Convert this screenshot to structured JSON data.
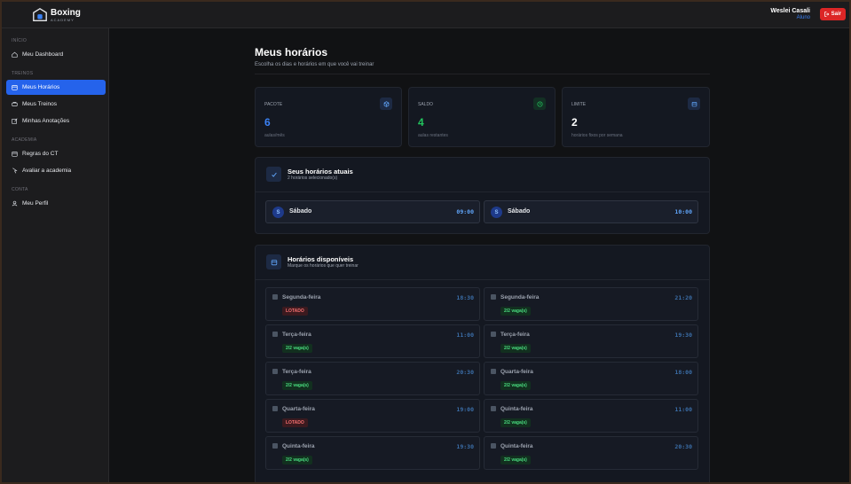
{
  "header": {
    "logo_title": "Boxing",
    "logo_sub": "ACADEMY",
    "user_name": "Weslei Casali",
    "user_role": "Aluno",
    "logout_label": "Sair"
  },
  "sidebar": {
    "sections": [
      {
        "title": "INÍCIO",
        "items": [
          {
            "label": "Meu Dashboard",
            "icon": "home-icon"
          }
        ]
      },
      {
        "title": "TREINOS",
        "items": [
          {
            "label": "Meus Horários",
            "icon": "calendar-icon",
            "active": true
          },
          {
            "label": "Meus Treinos",
            "icon": "dumbbell-icon"
          },
          {
            "label": "Minhas Anotações",
            "icon": "edit-icon"
          }
        ]
      },
      {
        "title": "ACADEMIA",
        "items": [
          {
            "label": "Regras do CT",
            "icon": "calendar-icon"
          },
          {
            "label": "Avaliar a academia",
            "icon": "pointer-icon"
          }
        ]
      },
      {
        "title": "CONTA",
        "items": [
          {
            "label": "Meu Perfil",
            "icon": "user-icon"
          }
        ]
      }
    ]
  },
  "page": {
    "title": "Meus horários",
    "subtitle": "Escolha os dias e horários em que você vai treinar"
  },
  "stats": [
    {
      "label": "PACOTE",
      "value": "6",
      "caption": "aulas/mês",
      "color": "#3b82f6",
      "icon": "box-icon"
    },
    {
      "label": "SALDO",
      "value": "4",
      "caption": "aulas restantes",
      "color": "#22c55e",
      "icon": "clock-icon"
    },
    {
      "label": "LIMITE",
      "value": "2",
      "caption": "horários fixos por semana",
      "color": "#ffffff",
      "icon": "calendar-icon"
    }
  ],
  "current": {
    "title": "Seus horários atuais",
    "subtitle": "2 horários selecionado(s)",
    "slots": [
      {
        "initial": "S",
        "day": "Sábado",
        "time": "09:00"
      },
      {
        "initial": "S",
        "day": "Sábado",
        "time": "10:00"
      }
    ]
  },
  "available": {
    "title": "Horários disponíveis",
    "subtitle": "Marque os horários que quer treinar",
    "slots": [
      {
        "day": "Segunda-feira",
        "time": "18:30",
        "status": "LOTADO",
        "full": true
      },
      {
        "day": "Segunda-feira",
        "time": "21:20",
        "status": "2/2 vaga(s)",
        "full": false
      },
      {
        "day": "Terça-feira",
        "time": "11:00",
        "status": "2/2 vaga(s)",
        "full": false
      },
      {
        "day": "Terça-feira",
        "time": "19:30",
        "status": "2/2 vaga(s)",
        "full": false
      },
      {
        "day": "Terça-feira",
        "time": "20:30",
        "status": "2/2 vaga(s)",
        "full": false
      },
      {
        "day": "Quarta-feira",
        "time": "18:00",
        "status": "2/2 vaga(s)",
        "full": false
      },
      {
        "day": "Quarta-feira",
        "time": "19:00",
        "status": "LOTADO",
        "full": true
      },
      {
        "day": "Quinta-feira",
        "time": "11:00",
        "status": "2/2 vaga(s)",
        "full": false
      },
      {
        "day": "Quinta-feira",
        "time": "19:30",
        "status": "2/2 vaga(s)",
        "full": false
      },
      {
        "day": "Quinta-feira",
        "time": "20:30",
        "status": "2/2 vaga(s)",
        "full": false
      }
    ]
  }
}
